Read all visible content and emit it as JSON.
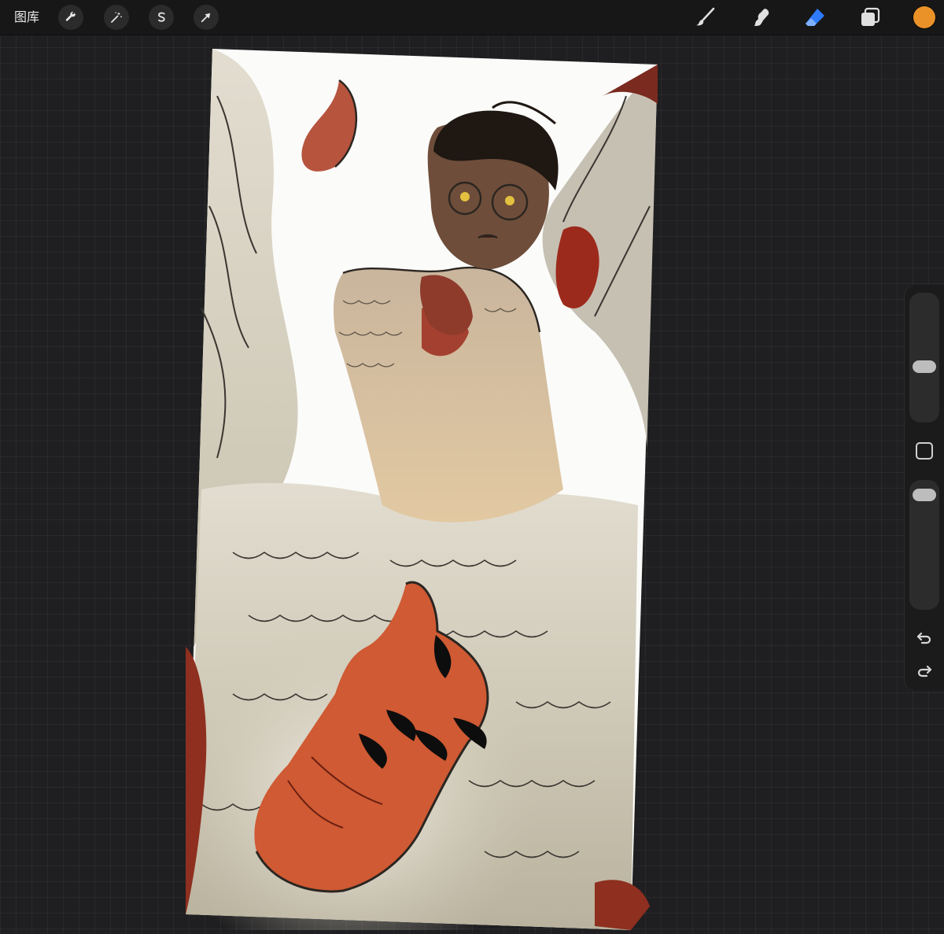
{
  "topbar": {
    "gallery_label": "图库",
    "left_tools": [
      {
        "name": "actions",
        "icon": "wrench-icon"
      },
      {
        "name": "adjustments",
        "icon": "magic-wand-icon"
      },
      {
        "name": "selection",
        "icon": "selection-s-icon"
      },
      {
        "name": "transform",
        "icon": "arrow-cursor-icon"
      }
    ],
    "right_tools": [
      {
        "name": "brush",
        "icon": "brush-icon",
        "active": false
      },
      {
        "name": "smudge",
        "icon": "smudge-icon",
        "active": false
      },
      {
        "name": "eraser",
        "icon": "eraser-icon",
        "active": true
      },
      {
        "name": "layers",
        "icon": "layers-icon",
        "active": false
      }
    ],
    "active_color": "#ea9228",
    "active_tool_color": "#2f7bff"
  },
  "sidebar": {
    "brush_size_level": 0.42,
    "opacity_level": 0.95,
    "icons": [
      "modifier-square-icon",
      "undo-icon",
      "redo-icon"
    ]
  },
  "canvas": {
    "background_color": "#1f1f21"
  }
}
